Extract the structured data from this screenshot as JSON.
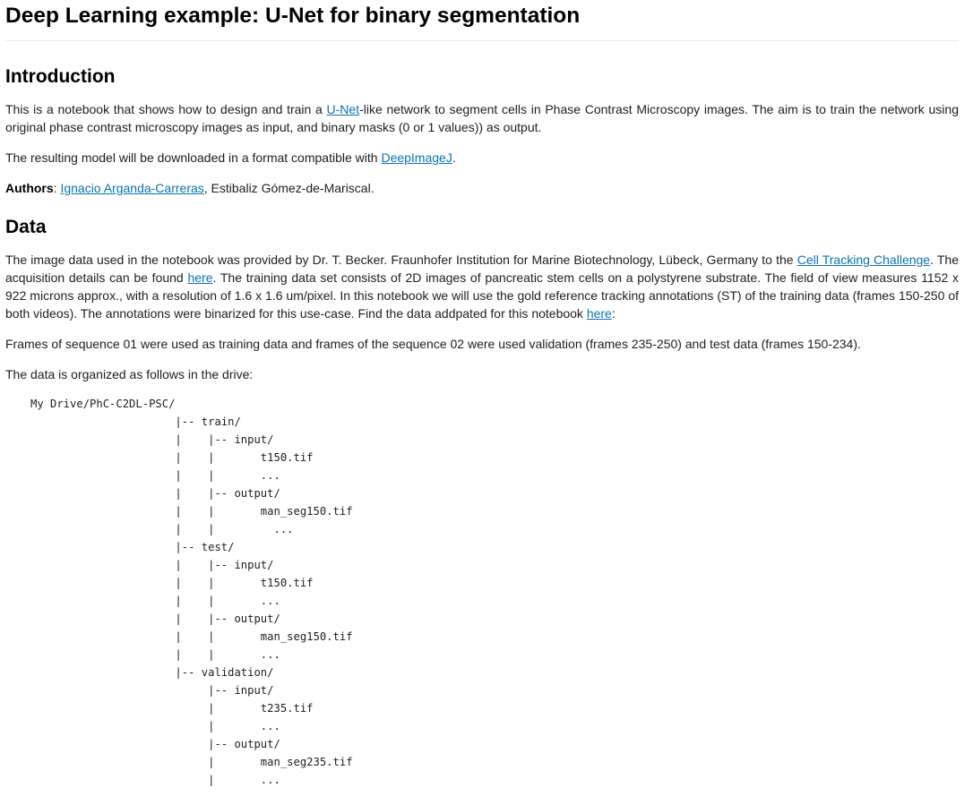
{
  "title": "Deep Learning example: U-Net for binary segmentation",
  "intro": {
    "heading": "Introduction",
    "p1": {
      "before": "This is a notebook that shows how to design and train a ",
      "link": "U-Net",
      "after": "-like network to segment cells in Phase Contrast Microscopy images. The aim is to train the network using original phase contrast microscopy images as input, and binary masks (0 or 1 values)) as output."
    },
    "p2": {
      "before": "The resulting model will be downloaded in a format compatible with ",
      "link": "DeepImageJ",
      "after": "."
    },
    "authors": {
      "label": "Authors",
      "sep": ": ",
      "link": "Ignacio Arganda-Carreras",
      "after": ", Estibaliz Gómez-de-Mariscal."
    }
  },
  "data_section": {
    "heading": "Data",
    "p1": {
      "t1": "The image data used in the notebook was provided by Dr. T. Becker. Fraunhofer Institution for Marine Biotechnology, Lübeck, Germany to the ",
      "link1": "Cell Tracking Challenge",
      "t2": ". The acquisition details can be found ",
      "link2": "here",
      "t3": ". The training data set consists of 2D images of pancreatic stem cells on a polystyrene substrate. The field of view measures 1152 x 922 microns approx., with a resolution of 1.6 x 1.6 um/pixel. In this notebook we will use the gold reference tracking annotations (ST) of the training data (frames 150-250 of both videos). The annotations were binarized for this use-case. Find the data addpated for this notebook ",
      "link3": "here",
      "t4": ":"
    },
    "p2": "Frames of sequence 01 were used as training data and frames of the sequence 02 were used validation (frames 235-250) and test data (frames 150-234).",
    "p3": "The data is organized as follows in the drive:",
    "tree": "My Drive/PhC-C2DL-PSC/\n                      |-- train/\n                      |    |-- input/\n                      |    |       t150.tif\n                      |    |       ...\n                      |    |-- output/\n                      |    |       man_seg150.tif\n                      |    |         ...\n                      |-- test/\n                      |    |-- input/\n                      |    |       t150.tif\n                      |    |       ...\n                      |    |-- output/\n                      |    |       man_seg150.tif\n                      |    |       ...\n                      |-- validation/\n                           |-- input/\n                           |       t235.tif\n                           |       ...\n                           |-- output/\n                           |       man_seg235.tif\n                           |       ..."
  },
  "colors": {
    "link": "#0a72b0",
    "text": "#1e1e1e",
    "divider": "#e8e8e8"
  }
}
